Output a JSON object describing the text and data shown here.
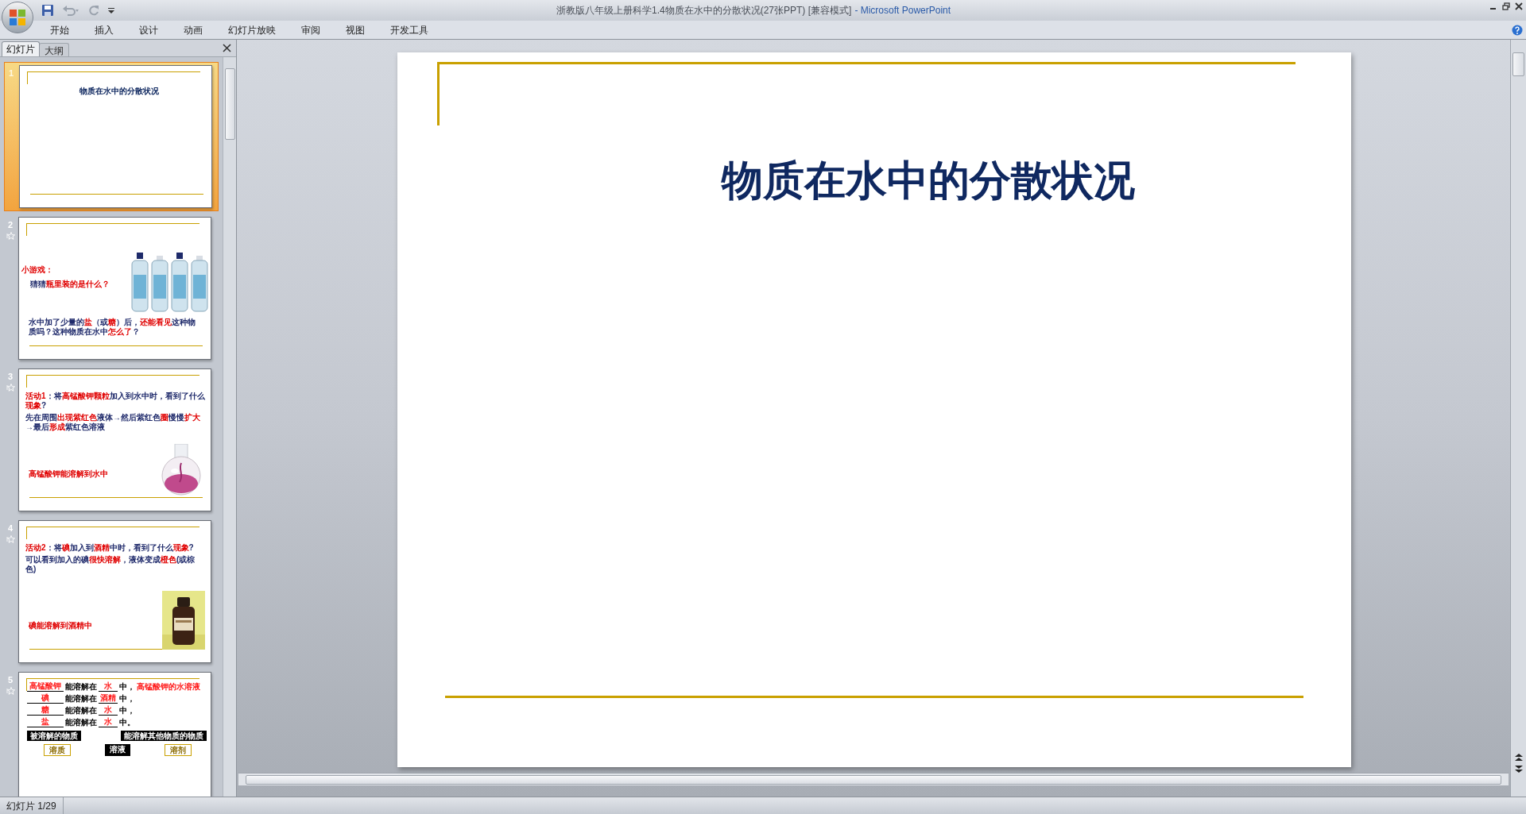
{
  "window": {
    "document_title": "浙教版八年级上册科学1.4物质在水中的分散状况(27张PPT) [兼容模式]",
    "app_name": "- Microsoft PowerPoint"
  },
  "ribbon_tabs": [
    {
      "label": "开始"
    },
    {
      "label": "插入"
    },
    {
      "label": "设计"
    },
    {
      "label": "动画"
    },
    {
      "label": "幻灯片放映"
    },
    {
      "label": "审阅"
    },
    {
      "label": "视图"
    },
    {
      "label": "开发工具"
    }
  ],
  "panel": {
    "tabs": [
      {
        "label": "幻灯片",
        "selected": true
      },
      {
        "label": "大纲",
        "selected": false
      }
    ],
    "slides": [
      {
        "number": "1",
        "selected": true,
        "has_animation": false,
        "kind": "title",
        "title": "物质在水中的分散状况"
      },
      {
        "number": "2",
        "selected": false,
        "has_animation": true,
        "kind": "bottles",
        "blocks": [
          [
            {
              "text": "小游戏：",
              "highlight": true
            }
          ],
          [
            {
              "text": "猜猜",
              "highlight": false
            },
            {
              "text": "瓶里装的是什么？",
              "highlight": true
            }
          ],
          [
            {
              "text": "水中加了少量的",
              "highlight": false
            },
            {
              "text": "盐",
              "highlight": true
            },
            {
              "text": "（或",
              "highlight": false
            },
            {
              "text": "糖",
              "highlight": true
            },
            {
              "text": "）后，",
              "highlight": false
            },
            {
              "text": "还能看见",
              "highlight": true
            },
            {
              "text": "这种物质吗？这种物质在水中",
              "highlight": false
            },
            {
              "text": "怎么了",
              "highlight": true
            },
            {
              "text": "？",
              "highlight": false
            }
          ]
        ]
      },
      {
        "number": "3",
        "selected": false,
        "has_animation": true,
        "kind": "flask",
        "blocks": [
          [
            {
              "text": "活动1",
              "highlight": true
            },
            {
              "text": "：将",
              "highlight": false
            },
            {
              "text": "高锰酸钾颗粒",
              "highlight": true
            },
            {
              "text": "加入到水中时，看到了什么",
              "highlight": false
            },
            {
              "text": "现象",
              "highlight": true
            },
            {
              "text": "?",
              "highlight": false
            }
          ],
          [
            {
              "text": "先在周围",
              "highlight": false
            },
            {
              "text": "出现紫红色",
              "highlight": true
            },
            {
              "text": "液体→然后紫红色",
              "highlight": false
            },
            {
              "text": "圈",
              "highlight": true
            },
            {
              "text": "慢慢",
              "highlight": false
            },
            {
              "text": "扩大",
              "highlight": true
            },
            {
              "text": "→最后",
              "highlight": false
            },
            {
              "text": "形成",
              "highlight": true
            },
            {
              "text": "紫红色溶液",
              "highlight": false
            }
          ],
          [
            {
              "text": "高锰酸钾能溶解到水中",
              "highlight": true
            }
          ]
        ]
      },
      {
        "number": "4",
        "selected": false,
        "has_animation": true,
        "blocks": [
          [
            {
              "text": "活动2",
              "highlight": true
            },
            {
              "text": "：将",
              "highlight": false
            },
            {
              "text": "碘",
              "highlight": true
            },
            {
              "text": "加入到",
              "highlight": false
            },
            {
              "text": "酒精",
              "highlight": true
            },
            {
              "text": "中时，看到了什么",
              "highlight": false
            },
            {
              "text": "现象",
              "highlight": true
            },
            {
              "text": "?",
              "highlight": false
            }
          ],
          [
            {
              "text": "可以看到加入的碘",
              "highlight": false
            },
            {
              "text": "很快溶解",
              "highlight": true
            },
            {
              "text": "，液体变成",
              "highlight": false
            },
            {
              "text": "橙色",
              "highlight": true
            },
            {
              "text": "(或棕色)",
              "highlight": false
            }
          ],
          [
            {
              "text": "碘能溶解到酒精中",
              "highlight": true
            }
          ]
        ]
      },
      {
        "number": "5",
        "selected": false,
        "has_animation": true,
        "kind": "table",
        "rows": [
          {
            "solute": "高锰酸钾",
            "verb": "能溶解在",
            "solvent": "水",
            "end": "中，",
            "note": "高锰酸钾的水溶液"
          },
          {
            "solute": "碘",
            "verb": "能溶解在",
            "solvent": "酒精",
            "end": "中，"
          },
          {
            "solute": "糖",
            "verb": "能溶解在",
            "solvent": "水",
            "end": "中，"
          },
          {
            "solute": "盐",
            "verb": "能溶解在",
            "solvent": "水",
            "end": "中。"
          }
        ],
        "labels": [
          "被溶解的物质",
          "能溶解其他物质的物质"
        ],
        "terms": [
          "溶质",
          "溶液",
          "溶剂"
        ]
      }
    ]
  },
  "slide": {
    "title": "物质在水中的分散状况"
  },
  "status_bar": {
    "slide_counter": "幻灯片 1/29"
  }
}
